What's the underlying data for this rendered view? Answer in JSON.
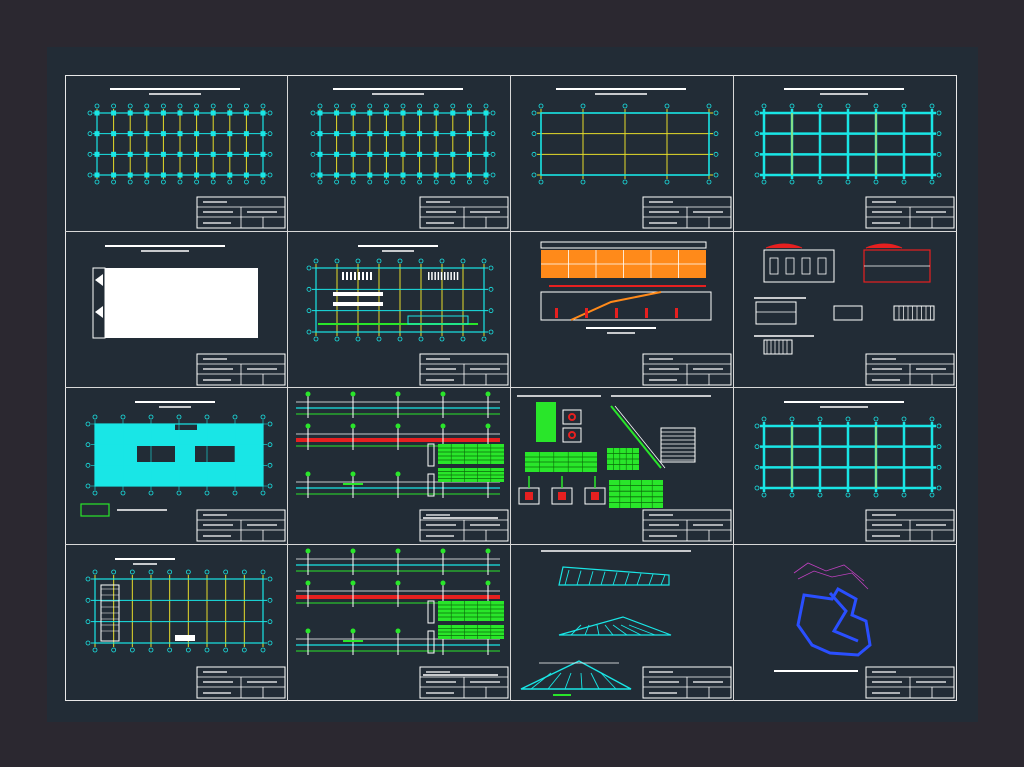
{
  "drawing": {
    "background_color": "#2b2830",
    "modelspace_color": "#222c36",
    "frame_color": "#e8e8e8",
    "colors": {
      "cyan": "#19e6e6",
      "yellow": "#e6dc2a",
      "white": "#ffffff",
      "green": "#29e62a",
      "red": "#e62020",
      "orange": "#ff8a1a",
      "blue": "#2a4fff",
      "magenta": "#c040c0"
    },
    "sheets": [
      {
        "id": "foundation-plan",
        "kind": "column-grid-plan"
      },
      {
        "id": "column-layout-plan",
        "kind": "column-grid-plan"
      },
      {
        "id": "beam-layout-plan",
        "kind": "beam-grid-plan"
      },
      {
        "id": "roof-framing-plan",
        "kind": "framing-grid-plan"
      },
      {
        "id": "site-plan",
        "kind": "white-block-plan"
      },
      {
        "id": "architectural-floor-plan",
        "kind": "floor-plan"
      },
      {
        "id": "elevation-and-section",
        "kind": "elevation"
      },
      {
        "id": "facade-details",
        "kind": "facade-details"
      },
      {
        "id": "slab-plan",
        "kind": "slab-plan"
      },
      {
        "id": "beam-reinforcement-details-1",
        "kind": "beam-details"
      },
      {
        "id": "column-and-stair-details",
        "kind": "column-details"
      },
      {
        "id": "upper-framing-plan",
        "kind": "framing-grid-plan"
      },
      {
        "id": "second-floor-plan",
        "kind": "floor-plan-2"
      },
      {
        "id": "beam-reinforcement-details-2",
        "kind": "beam-details"
      },
      {
        "id": "roof-truss-details",
        "kind": "truss-details"
      },
      {
        "id": "location-plan",
        "kind": "location-map"
      }
    ]
  }
}
